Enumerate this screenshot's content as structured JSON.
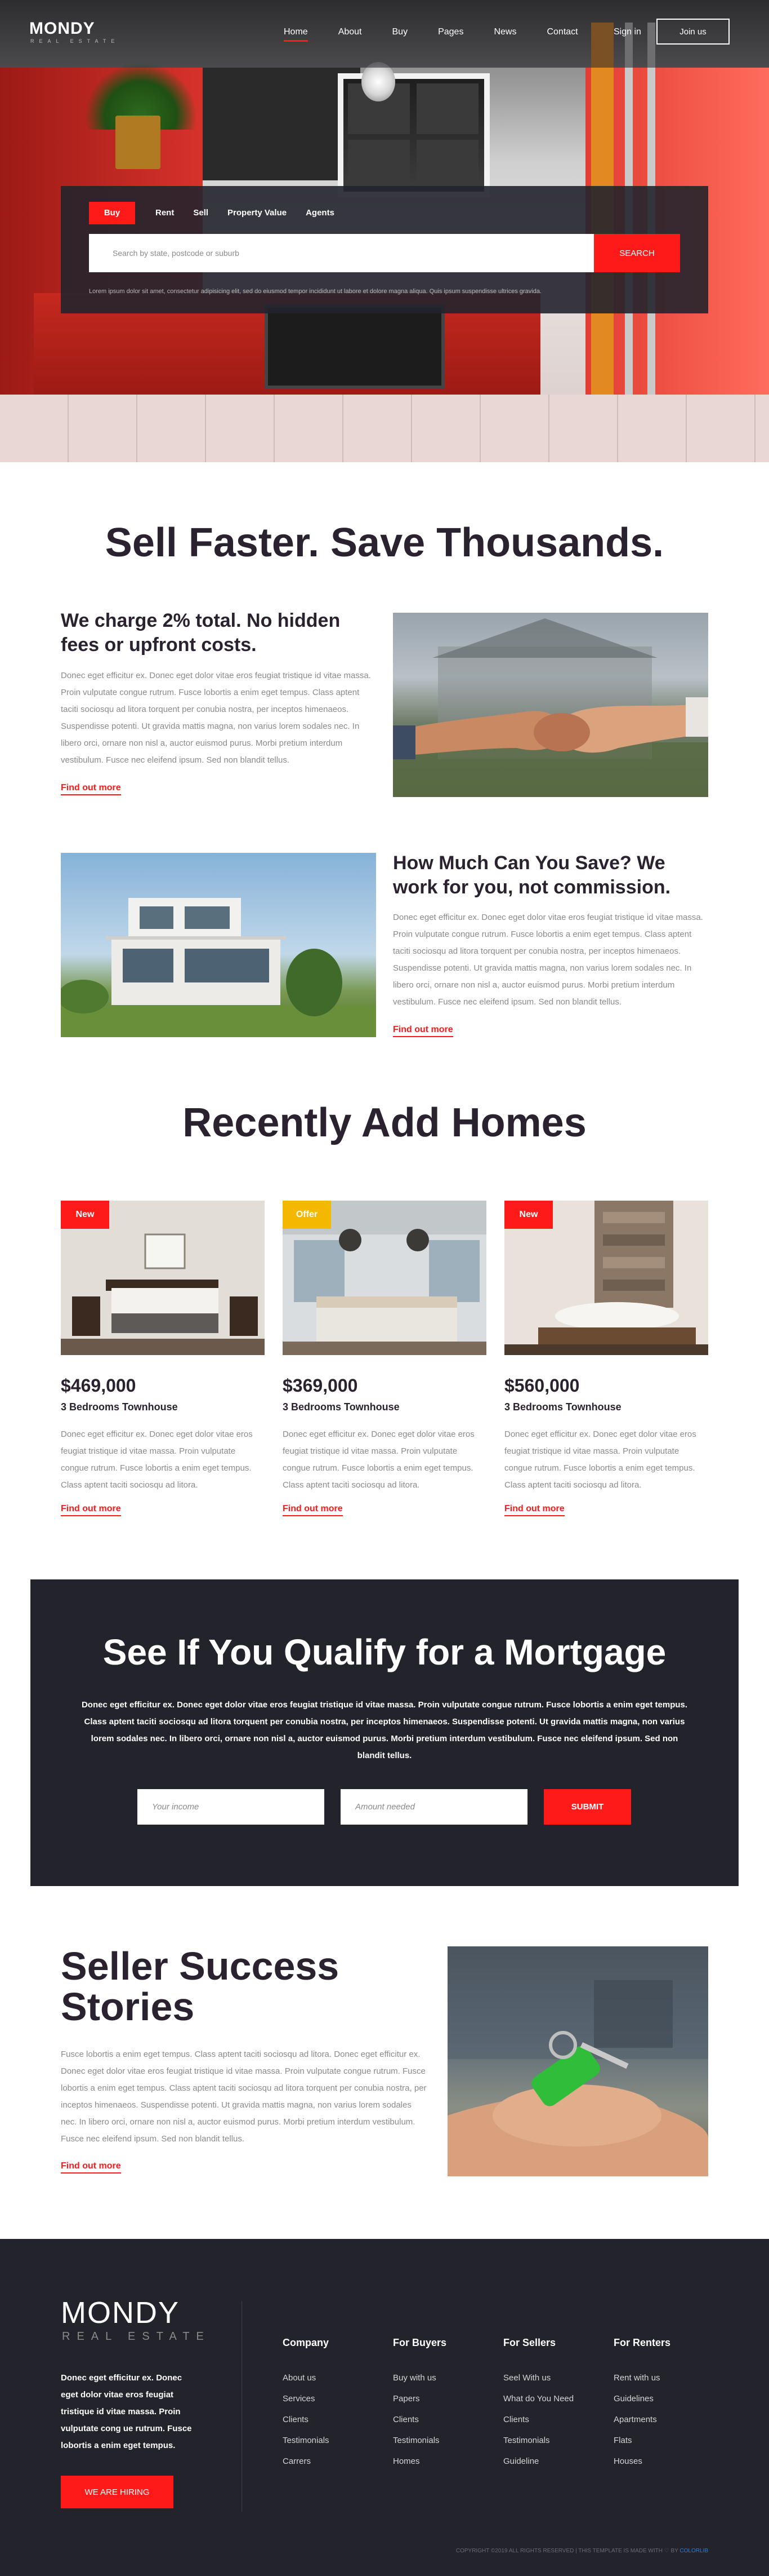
{
  "brand": {
    "name": "MONDY",
    "tagline": "REAL ESTATE"
  },
  "nav": {
    "items": [
      "Home",
      "About",
      "Buy",
      "Pages",
      "News",
      "Contact"
    ],
    "active": "Home",
    "signin": "Sign in",
    "join": "Join us"
  },
  "search": {
    "tabs": [
      "Buy",
      "Rent",
      "Sell",
      "Property Value",
      "Agents"
    ],
    "active_tab": "Buy",
    "placeholder": "Search by state, postcode or suburb",
    "button": "SEARCH",
    "note": "Lorem ipsum dolor sit amet, consectetur adipisicing elit, sed do eiusmod tempor incididunt ut labore et dolore magna aliqua. Quis ipsum suspendisse ultrices gravida."
  },
  "sell": {
    "title": "Sell Faster. Save Thousands.",
    "feature1": {
      "heading": "We charge 2% total. No hidden fees or upfront costs.",
      "text": "Donec eget efficitur ex. Donec eget dolor vitae eros feugiat tristique id vitae massa. Proin vulputate congue rutrum. Fusce lobortis a enim eget tempus. Class aptent taciti sociosqu ad litora torquent per conubia nostra, per inceptos himenaeos. Suspendisse potenti. Ut gravida mattis magna, non varius lorem sodales nec. In libero orci, ornare non nisl a, auctor euismod purus. Morbi pretium interdum vestibulum. Fusce nec eleifend ipsum. Sed non blandit tellus.",
      "link": "Find out more"
    },
    "feature2": {
      "heading": "How Much Can You Save? We work for you, not commission.",
      "text": "Donec eget efficitur ex. Donec eget dolor vitae eros feugiat tristique id vitae massa. Proin vulputate congue rutrum. Fusce lobortis a enim eget tempus. Class aptent taciti sociosqu ad litora torquent per conubia nostra, per inceptos himenaeos. Suspendisse potenti. Ut gravida mattis magna, non varius lorem sodales nec. In libero orci, ornare non nisl a, auctor euismod purus. Morbi pretium interdum vestibulum. Fusce nec eleifend ipsum. Sed non blandit tellus.",
      "link": "Find out more"
    }
  },
  "homes": {
    "title": "Recently Add Homes",
    "items": [
      {
        "badge": "New",
        "badge_color": "#ff1a1a",
        "price": "$469,000",
        "subtitle": "3 Bedrooms Townhouse",
        "text": "Donec eget efficitur ex. Donec eget dolor vitae eros feugiat tristique id vitae massa. Proin vulputate congue rutrum. Fusce lobortis a enim eget tempus. Class aptent taciti sociosqu ad litora.",
        "link": "Find out more"
      },
      {
        "badge": "Offer",
        "badge_color": "#f5b800",
        "price": "$369,000",
        "subtitle": "3 Bedrooms Townhouse",
        "text": "Donec eget efficitur ex. Donec eget dolor vitae eros feugiat tristique id vitae massa. Proin vulputate congue rutrum. Fusce lobortis a enim eget tempus. Class aptent taciti sociosqu ad litora.",
        "link": "Find out more"
      },
      {
        "badge": "New",
        "badge_color": "#ff1a1a",
        "price": "$560,000",
        "subtitle": "3 Bedrooms Townhouse",
        "text": "Donec eget efficitur ex. Donec eget dolor vitae eros feugiat tristique id vitae massa. Proin vulputate congue rutrum. Fusce lobortis a enim eget tempus. Class aptent taciti sociosqu ad litora.",
        "link": "Find out more"
      }
    ]
  },
  "mortgage": {
    "title": "See If You Qualify for a Mortgage",
    "text": "Donec eget efficitur ex. Donec eget dolor vitae eros feugiat tristique id vitae massa. Proin vulputate congue rutrum. Fusce lobortis a enim eget tempus. Class aptent taciti sociosqu ad litora torquent per conubia nostra, per inceptos himenaeos. Suspendisse potenti. Ut gravida mattis magna, non varius lorem sodales nec. In libero orci, ornare non nisl a, auctor euismod purus. Morbi pretium interdum vestibulum. Fusce nec eleifend ipsum. Sed non blandit tellus.",
    "income_placeholder": "Your income",
    "amount_placeholder": "Amount needed",
    "button": "SUBMIT"
  },
  "success": {
    "title": "Seller Success Stories",
    "text": "Fusce lobortis a enim eget tempus. Class aptent taciti sociosqu ad litora. Donec eget efficitur ex. Donec eget dolor vitae eros feugiat tristique id vitae massa. Proin vulputate congue rutrum. Fusce lobortis a enim eget tempus. Class aptent taciti sociosqu ad litora torquent per conubia nostra, per inceptos himenaeos. Suspendisse potenti. Ut gravida mattis magna, non varius lorem sodales nec. In libero orci, ornare non nisl a, auctor euismod purus. Morbi pretium interdum vestibulum. Fusce nec eleifend ipsum. Sed non blandit tellus.",
    "link": "Find out more"
  },
  "footer": {
    "logo": "MONDY",
    "logo_sub": "REAL ESTATE",
    "description": "Donec eget efficitur ex. Donec eget dolor vitae eros feugiat tristique id vitae massa. Proin vulputate cong ue rutrum. Fusce lobortis a enim eget tempus.",
    "hiring": "WE ARE HIRING",
    "columns": [
      {
        "title": "Company",
        "links": [
          "About us",
          "Services",
          "Clients",
          "Testimonials",
          "Carrers"
        ]
      },
      {
        "title": "For Buyers",
        "links": [
          "Buy with us",
          "Papers",
          "Clients",
          "Testimonials",
          "Homes"
        ]
      },
      {
        "title": "For Sellers",
        "links": [
          "Seel With us",
          "What do You Need",
          "Clients",
          "Testimonials",
          "Guideline"
        ]
      },
      {
        "title": "For Renters",
        "links": [
          "Rent with us",
          "Guidelines",
          "Apartments",
          "Flats",
          "Houses"
        ]
      }
    ],
    "copyright": "COPYRIGHT ©2019 ALL RIGHTS RESERVED | THIS TEMPLATE IS MADE WITH ♡ BY",
    "copyright_credit": "COLORLIB"
  },
  "colors": {
    "accent": "#ff1a1a",
    "dark": "#22232b",
    "heading": "#2b2230",
    "offer": "#f5b800"
  }
}
